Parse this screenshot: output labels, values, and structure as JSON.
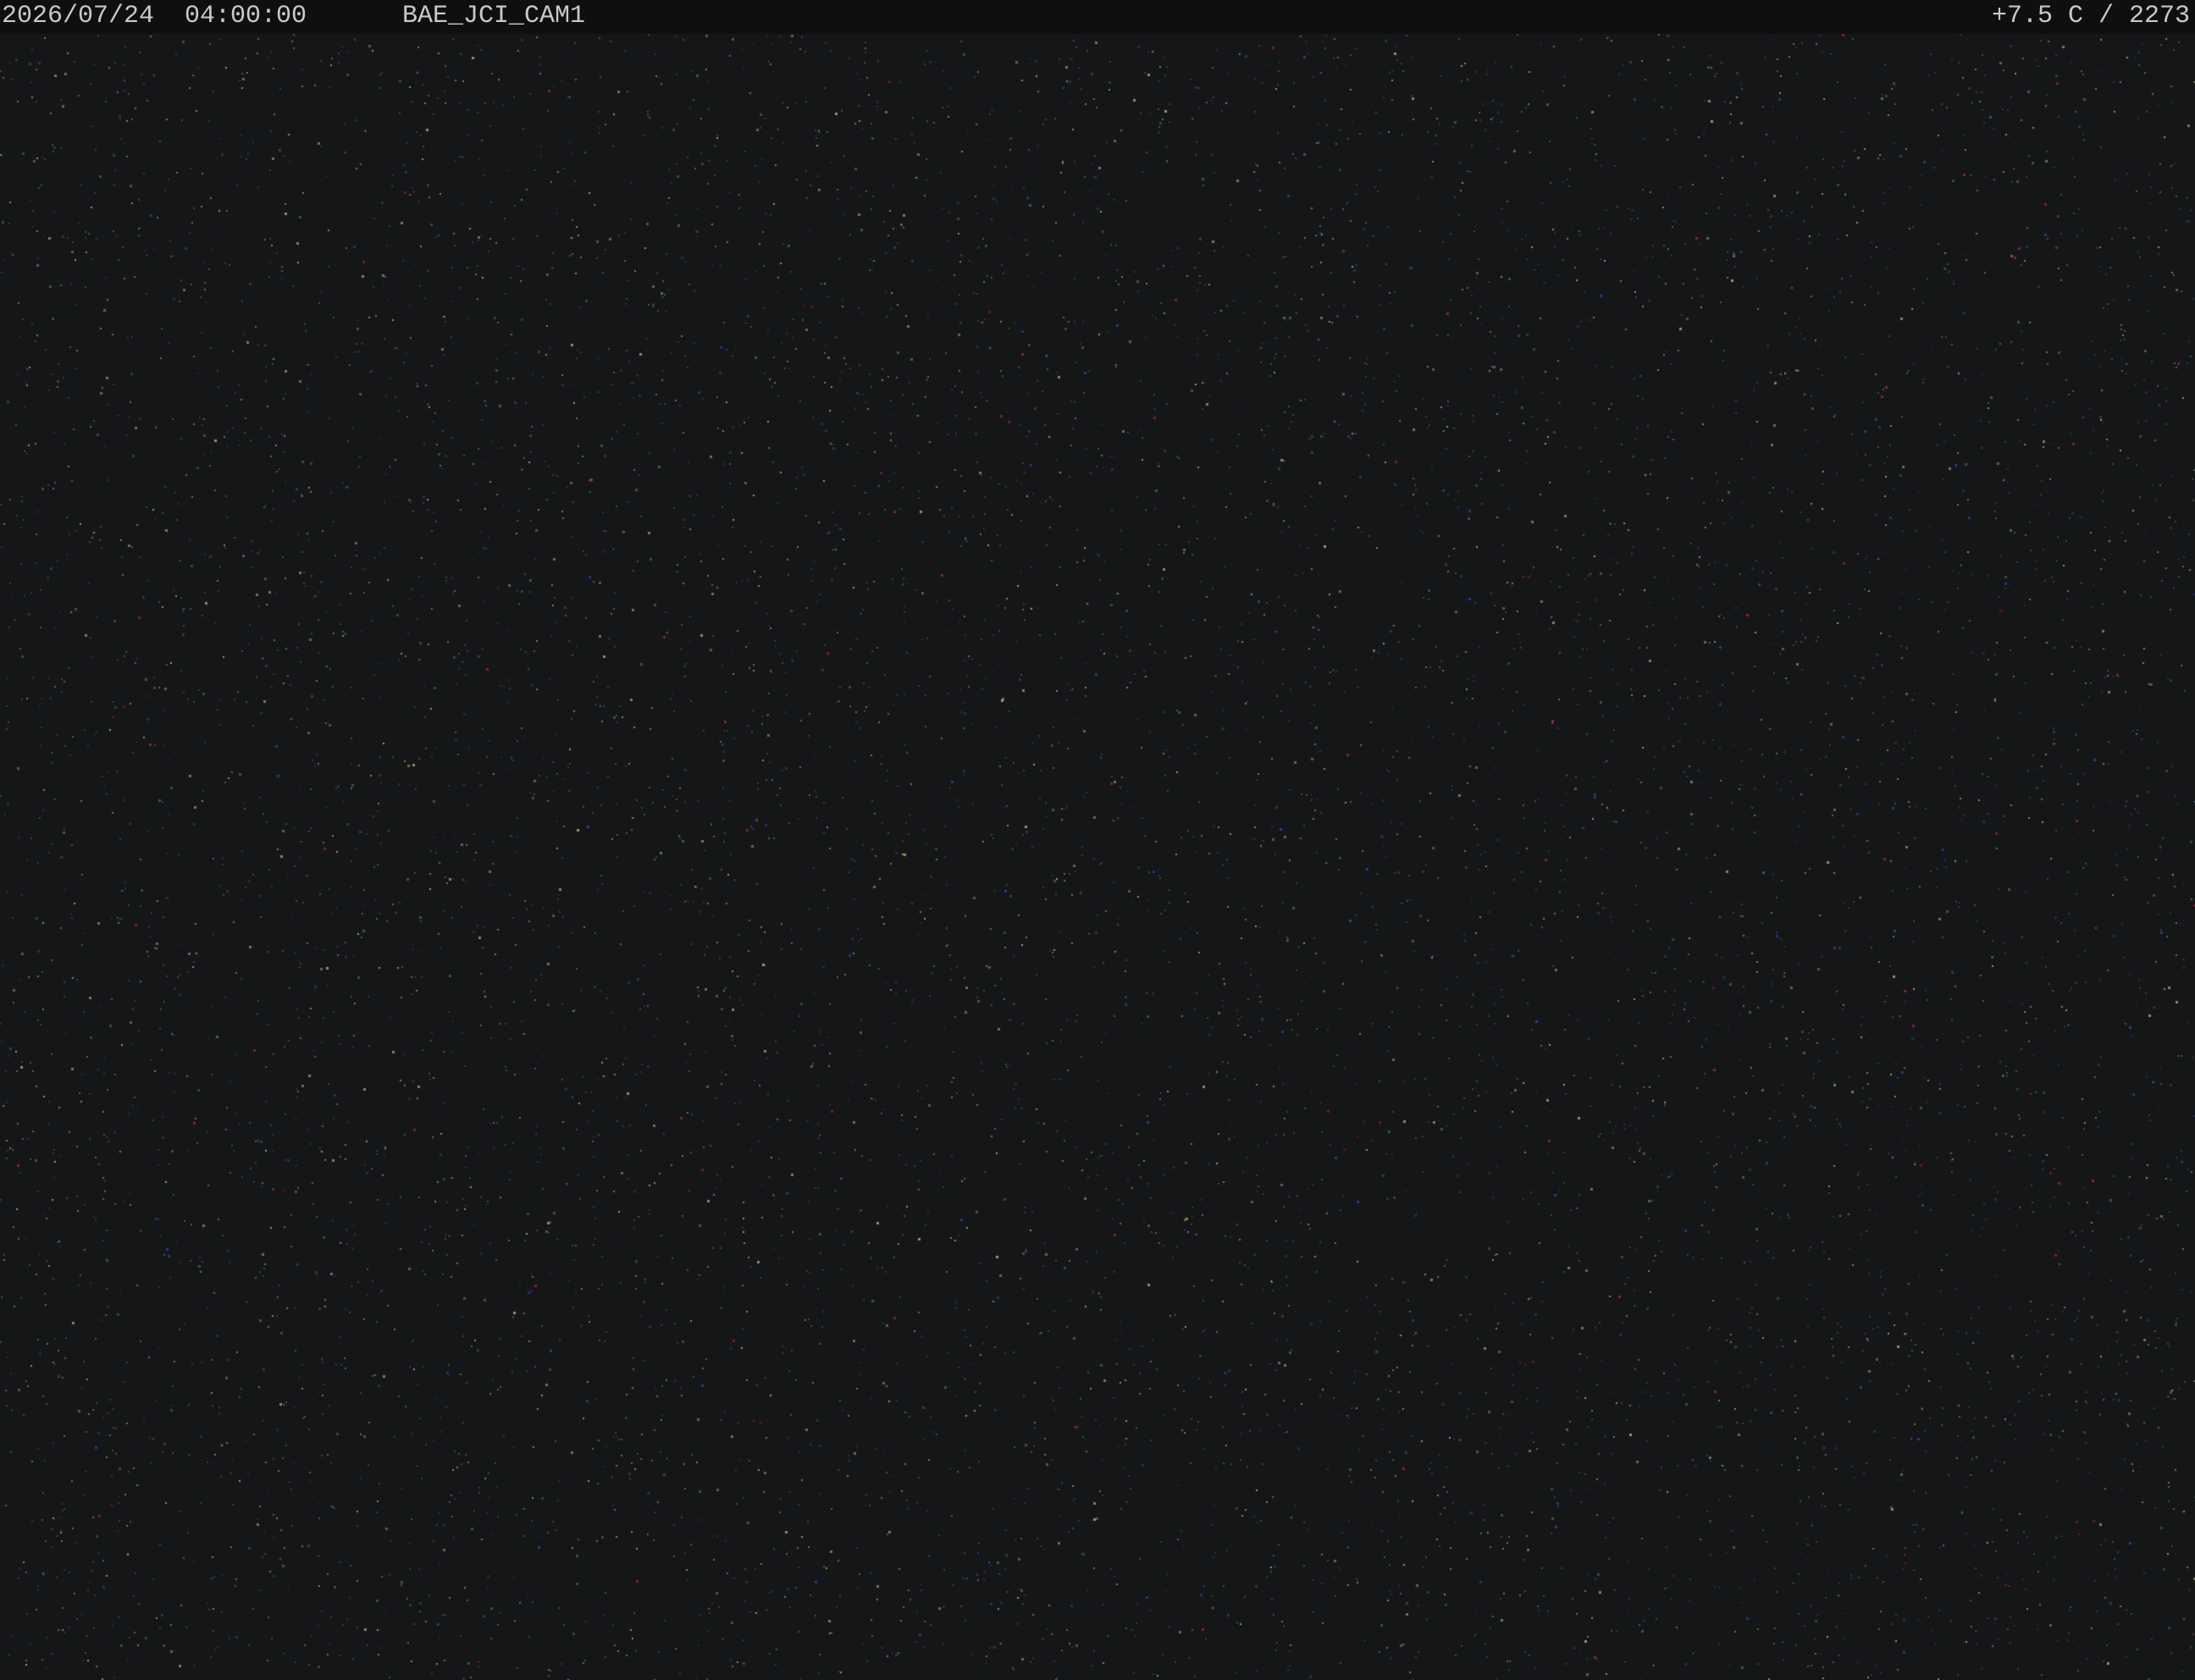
{
  "overlay": {
    "timestamp": "2026/07/24  04:00:00",
    "camera_id": "BAE_JCI_CAM1",
    "reading": "+7.5 C / 2273"
  },
  "scene": {
    "description_kind": "dark night camera frame with sparse colored sensor noise",
    "background_color": "#151617",
    "noise_colors": [
      "#9a2a3a",
      "#3a3fa0",
      "#3c6e44",
      "#8a8a8a",
      "#b0b080"
    ]
  }
}
